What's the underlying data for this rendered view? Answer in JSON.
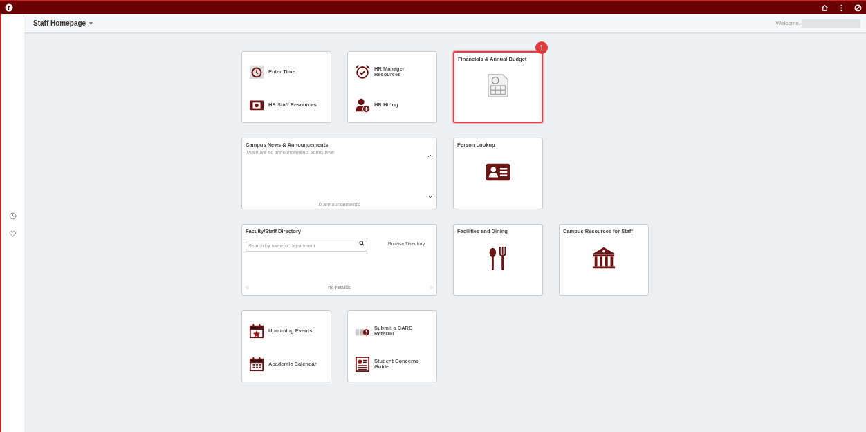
{
  "header": {
    "title": "Staff Homepage",
    "welcome": "Welcome,"
  },
  "tile_rows": [
    [
      {
        "kind": "links",
        "links": [
          {
            "label": "Enter Time"
          },
          {
            "label": "HR Staff Resources"
          }
        ]
      },
      {
        "kind": "links",
        "links": [
          {
            "label": "HR Manager Resources"
          },
          {
            "label": "HR Hiring"
          }
        ]
      },
      {
        "kind": "icon",
        "title": "Financials & Annual Budget",
        "highlighted": true,
        "callout": "1"
      }
    ],
    [
      {
        "kind": "news",
        "title": "Campus News & Announcements",
        "message": "There are no announcements at this time",
        "footer": "0 announcements"
      },
      {
        "kind": "icon",
        "title": "Person Lookup",
        "highlighted": false
      }
    ],
    [
      {
        "kind": "directory",
        "title": "Faculty/Staff Directory",
        "placeholder": "Search by name or department",
        "link": "Browse Directory",
        "prev": "«",
        "next": "»",
        "footer": "no results"
      },
      {
        "kind": "icon",
        "title": "Facilities and Dining",
        "highlighted": false
      },
      {
        "kind": "icon",
        "title": "Campus Resources for Staff",
        "highlighted": false
      }
    ],
    [
      {
        "kind": "links",
        "links": [
          {
            "label": "Upcoming Events"
          },
          {
            "label": "Academic Calendar"
          }
        ]
      },
      {
        "kind": "links",
        "links": [
          {
            "label": "Submit a CARE Referral"
          },
          {
            "label": "Student Concerns Guide"
          }
        ]
      }
    ]
  ]
}
